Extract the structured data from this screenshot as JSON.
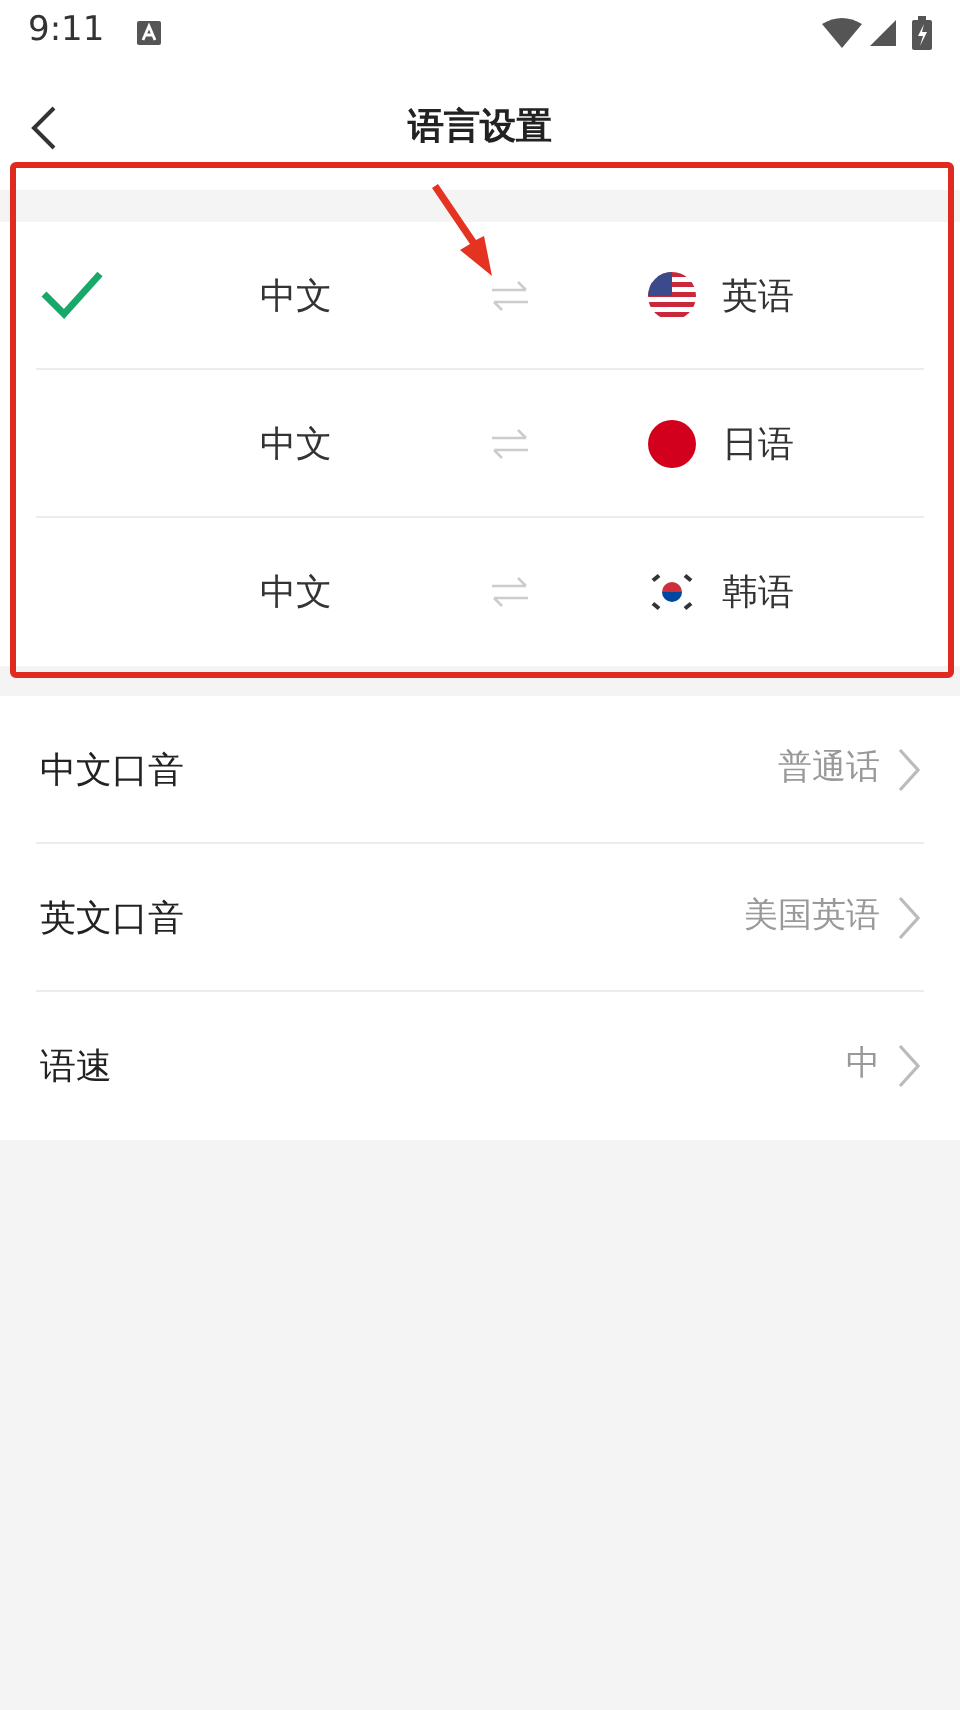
{
  "status_bar": {
    "time": "9:11"
  },
  "header": {
    "title": "语言设置"
  },
  "language_pairs": [
    {
      "source": "中文",
      "target": "英语",
      "kind": "us",
      "selected": true
    },
    {
      "source": "中文",
      "target": "日语",
      "kind": "jp",
      "selected": false
    },
    {
      "source": "中文",
      "target": "韩语",
      "kind": "kr",
      "selected": false
    }
  ],
  "settings": [
    {
      "label": "中文口音",
      "value": "普通话"
    },
    {
      "label": "英文口音",
      "value": "美国英语"
    },
    {
      "label": "语速",
      "value": "中"
    }
  ]
}
